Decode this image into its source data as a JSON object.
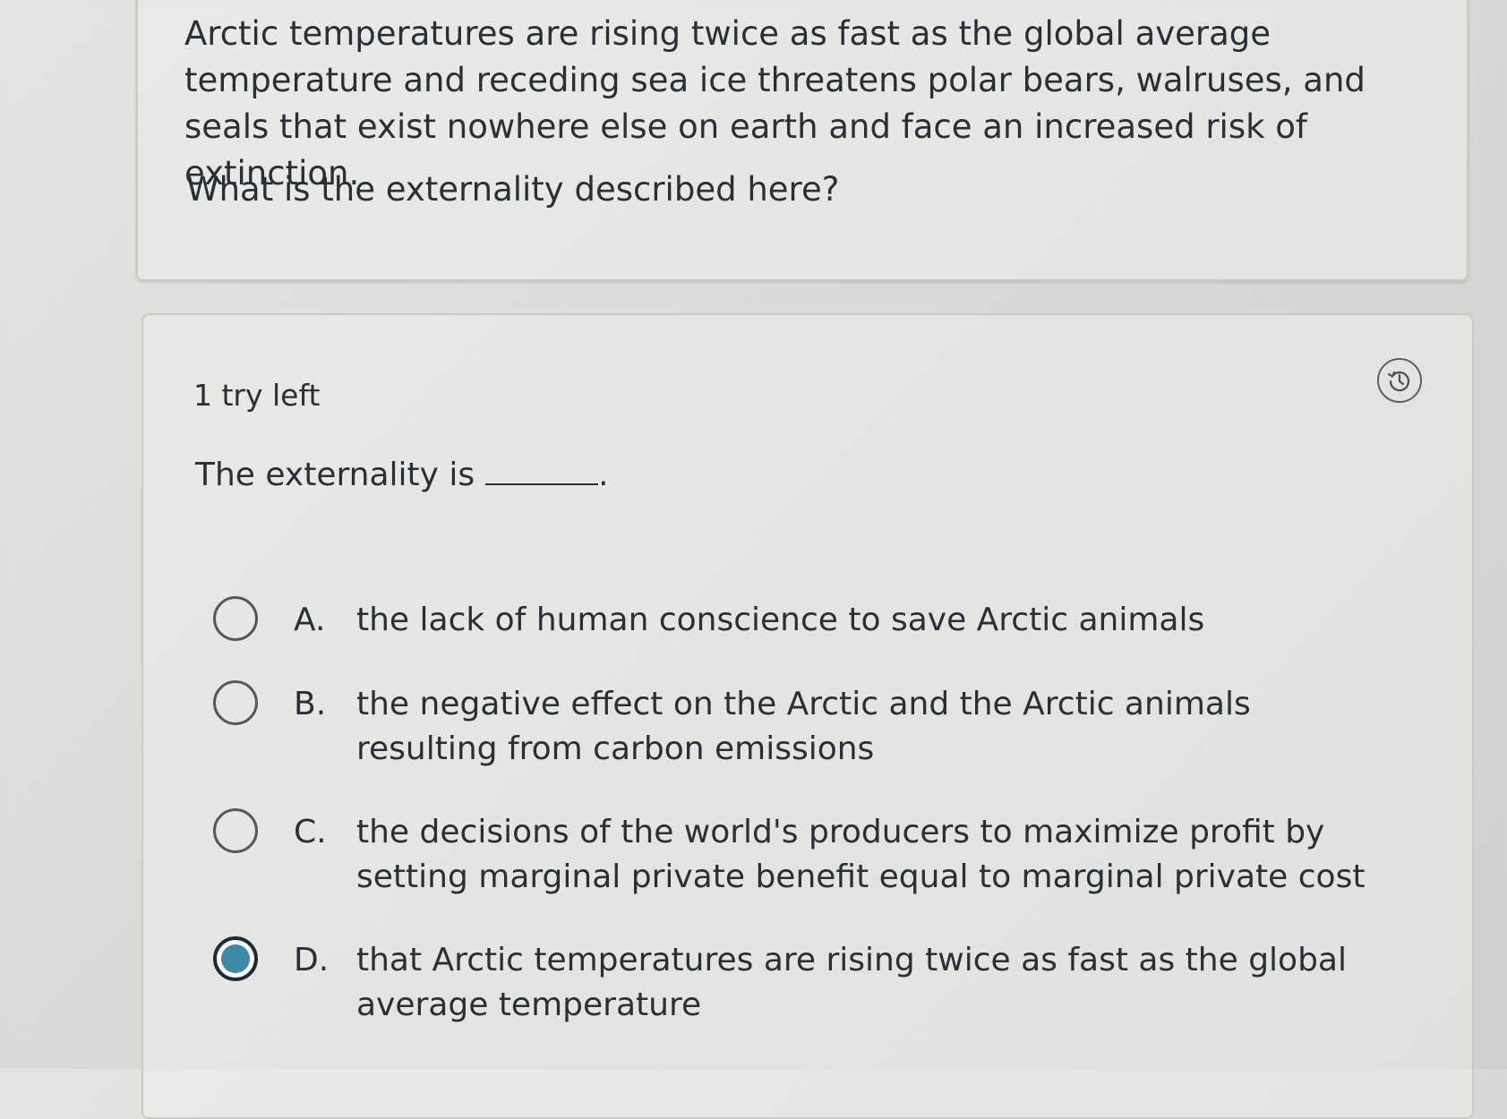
{
  "question": {
    "stem": "Arctic temperatures are rising twice as fast as the global average temperature and receding sea ice threatens polar bears, walruses, and seals that exist nowhere else on earth and face an increased risk of extinction.",
    "prompt": "What is the externality described here?"
  },
  "answer": {
    "tries_left": "1 try left",
    "history_icon": "history-icon",
    "sentence_start": "The externality is",
    "sentence_end": ".",
    "options": [
      {
        "letter": "A.",
        "text": "the lack of human conscience to save Arctic animals",
        "selected": false
      },
      {
        "letter": "B.",
        "text": "the negative effect on the Arctic and the Arctic animals resulting from carbon emissions",
        "selected": false
      },
      {
        "letter": "C.",
        "text": "the decisions of the world's producers to maximize profit by setting marginal private benefit equal to marginal private cost",
        "selected": false
      },
      {
        "letter": "D.",
        "text": "that Arctic temperatures are rising twice as fast as the global average temperature",
        "selected": true
      }
    ]
  },
  "colors": {
    "accent": "#3e8aa6",
    "text": "#2a2f36",
    "border": "#c9c9c6"
  }
}
